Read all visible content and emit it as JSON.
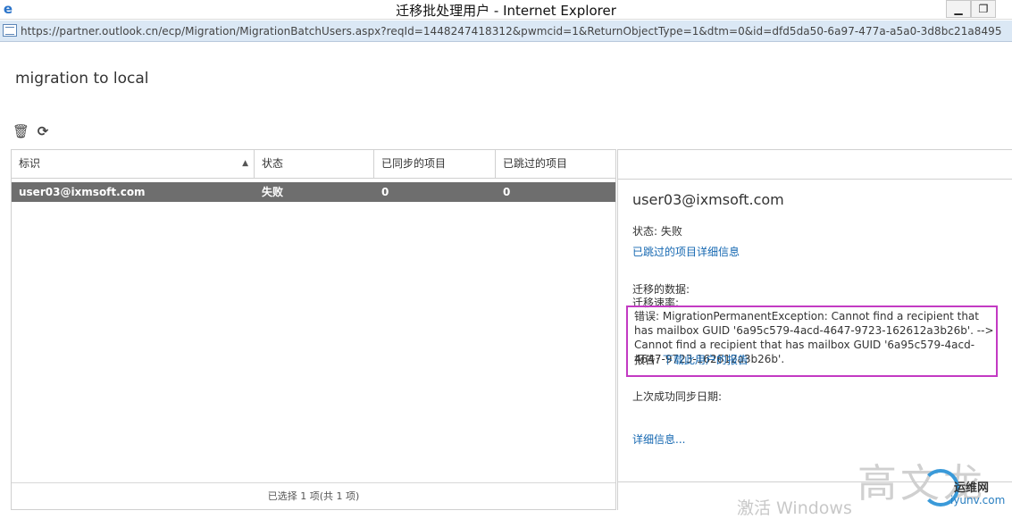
{
  "window": {
    "title": "迁移批处理用户 - Internet Explorer",
    "minimize_glyph": "▁",
    "restore_glyph": "❐"
  },
  "address": {
    "url": "https://partner.outlook.cn/ecp/Migration/MigrationBatchUsers.aspx?reqId=1448247418312&pwmcid=1&ReturnObjectType=1&dtm=0&id=dfd5da50-6a97-477a-a5a0-3d8bc21a8495"
  },
  "page": {
    "title": "migration to local"
  },
  "toolbar": {
    "delete_icon": "🗑",
    "refresh_icon": "⟳"
  },
  "list": {
    "columns": [
      "标识",
      "状态",
      "已同步的项目",
      "已跳过的项目"
    ],
    "sort_indicator": "▲",
    "rows": [
      {
        "id": "user03@ixmsoft.com",
        "status": "失败",
        "synced": "0",
        "skipped": "0"
      }
    ],
    "footer": "已选择 1 项(共 1 项)"
  },
  "detail": {
    "name": "user03@ixmsoft.com",
    "status_line": "状态: 失败",
    "skipped_link": "已跳过的项目详细信息",
    "migrated_data": "迁移的数据:",
    "migration_rate": "迁移速率:",
    "error_text": "错误: MigrationPermanentException: Cannot find a recipient that has mailbox GUID '6a95c579-4acd-4647-9723-162612a3b26b'. --> Cannot find a recipient that has mailbox GUID '6a95c579-4acd-4647-9723-162612a3b26b'.",
    "report_label": "报告: ",
    "report_link": "下载此用户的报告",
    "last_sync": "上次成功同步日期:",
    "more_link": "详细信息..."
  },
  "watermark": {
    "activate": "激活 Windows",
    "brand_big": "高文龙",
    "brand_small": "运维网",
    "brand_url": "iyunv.com"
  },
  "colors": {
    "selected_row": "#6e6e6e",
    "link": "#1467b1",
    "error_highlight": "#c33ac3",
    "address_bar": "#dbe8f5"
  }
}
